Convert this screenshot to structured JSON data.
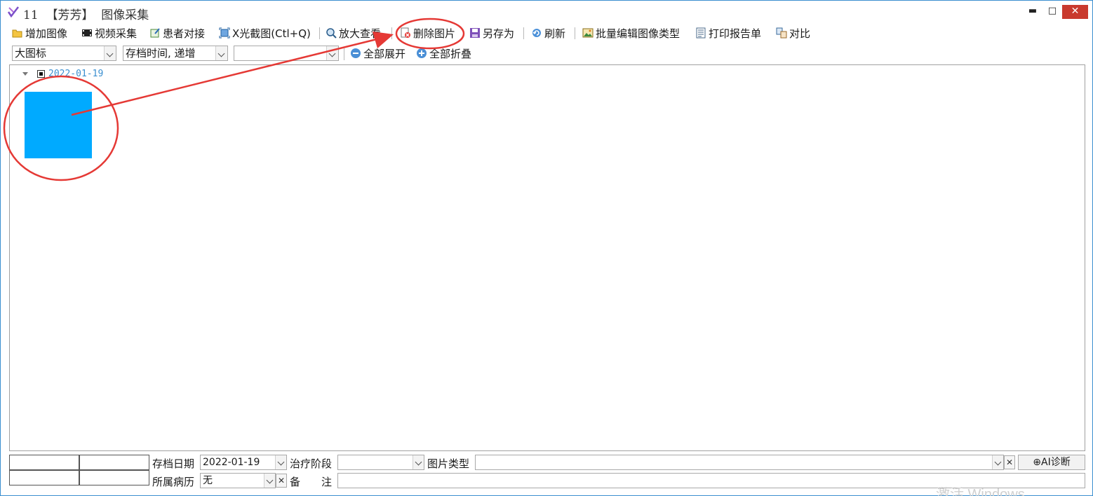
{
  "window": {
    "title": "11  【芳芳】  图像采集",
    "minimize_glyph": "▬",
    "maximize_glyph": "□",
    "close_glyph": "✕",
    "border_color": "#3a8fd0"
  },
  "toolbar": {
    "items": [
      {
        "label": "增加图像",
        "icon": "folder-open-icon"
      },
      {
        "label": "视频采集",
        "icon": "film-icon"
      },
      {
        "label": "患者对接",
        "icon": "edit-doc-icon"
      },
      {
        "label": "X光截图(Ctl+Q)",
        "icon": "screenshot-icon"
      },
      {
        "label": "放大查看",
        "icon": "zoom-icon"
      },
      {
        "label": "删除图片",
        "icon": "delete-image-icon"
      },
      {
        "label": "另存为",
        "icon": "save-as-icon"
      },
      {
        "label": "刷新",
        "icon": "refresh-icon"
      },
      {
        "label": "批量编辑图像类型",
        "icon": "image-edit-icon"
      },
      {
        "label": "打印报告单",
        "icon": "print-report-icon"
      },
      {
        "label": "对比",
        "icon": "compare-icon"
      }
    ]
  },
  "filters": {
    "view_mode": "大图标",
    "sort_order": "存档时间, 递增",
    "third_select": "",
    "expand_all": "全部展开",
    "collapse_all": "全部折叠"
  },
  "tree": {
    "group_date": "2022-01-19",
    "thumbnail_color": "#00aaff"
  },
  "annotation": {
    "color": "#e53935"
  },
  "form": {
    "archive_date_label": "存档日期",
    "archive_date_value": "2022-01-19",
    "treatment_stage_label": "治疗阶段",
    "treatment_stage_value": "",
    "image_type_label": "图片类型",
    "image_type_value": "",
    "case_label": "所属病历",
    "case_value": "无",
    "remark_label": "备　　注",
    "remark_value": "",
    "ai_button": "⊕AI诊断"
  },
  "watermark": "激活 Windows"
}
